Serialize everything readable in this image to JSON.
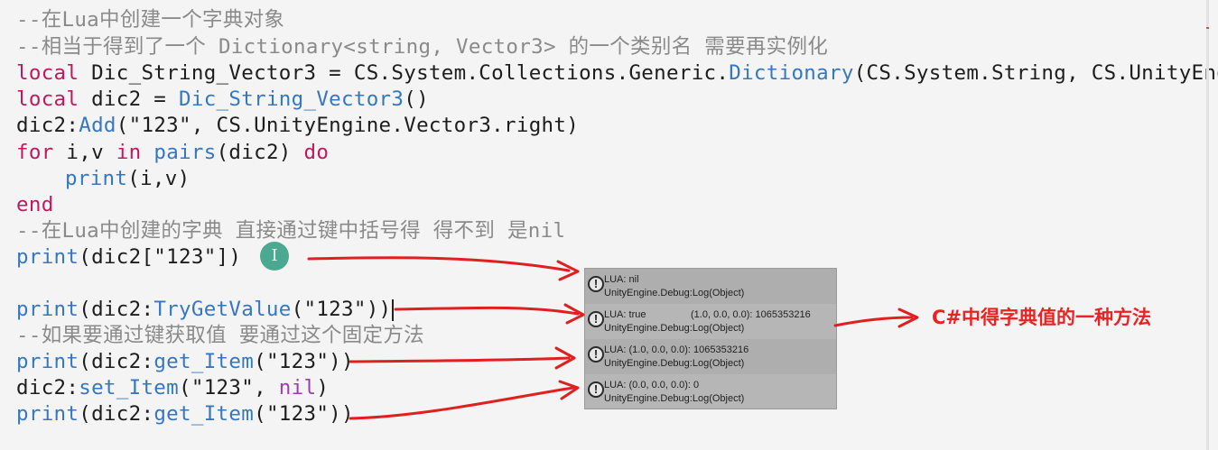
{
  "editor": {
    "lines": {
      "l1": "--在Lua中创建一个字典对象",
      "l2": "--相当于得到了一个 Dictionary<string, Vector3> 的一个类别名 需要再实例化",
      "l3": {
        "kw": "local",
        "rest1": " Dic_String_Vector3 = CS.System.Collections.Generic.",
        "fn": "Dictionary",
        "rest2": "(CS.System.String, CS.UnityEng"
      },
      "l4": {
        "kw": "local",
        "rest1": " dic2 = ",
        "fn": "Dic_String_Vector3",
        "rest2": "()"
      },
      "l5": {
        "pre": "dic2:",
        "fn": "Add",
        "rest": "(\"123\", CS.UnityEngine.Vector3.right)"
      },
      "l6": {
        "kw1": "for",
        "mid1": " i,v ",
        "kw2": "in",
        "mid2": " ",
        "fn": "pairs",
        "mid3": "(dic2) ",
        "kw3": "do"
      },
      "l7": {
        "fn": "print",
        "rest": "(i,v)"
      },
      "l8": "end",
      "l9": "--在Lua中创建的字典 直接通过键中括号得 得不到 是nil",
      "l10": {
        "fn": "print",
        "rest": "(dic2[\"123\"])"
      },
      "l11": {
        "fn": "print",
        "mid": "(dic2:",
        "fn2": "TryGetValue",
        "rest": "(\"123\"))"
      },
      "l12": "--如果要通过键获取值 要通过这个固定方法",
      "l13": {
        "fn": "print",
        "mid": "(dic2:",
        "fn2": "get_Item",
        "rest": "(\"123\"))"
      },
      "l14": {
        "pre": "dic2:",
        "fn": "set_Item",
        "mid": "(\"123\", ",
        "kv": "nil",
        "rest": ")"
      },
      "l15": {
        "fn": "print",
        "mid": "(dic2:",
        "fn2": "get_Item",
        "rest": "(\"123\"))"
      }
    },
    "cursor_glyph": "I"
  },
  "console": {
    "entries": [
      {
        "line1": "LUA: nil",
        "line2": "UnityEngine.Debug:Log(Object)"
      },
      {
        "line1": "LUA: true",
        "line1b": "(1.0, 0.0, 0.0): 1065353216",
        "line2": "UnityEngine.Debug:Log(Object)"
      },
      {
        "line1": "LUA: (1.0, 0.0, 0.0): 1065353216",
        "line2": "UnityEngine.Debug:Log(Object)"
      },
      {
        "line1": "LUA: (0.0, 0.0, 0.0): 0",
        "line2": "UnityEngine.Debug:Log(Object)"
      }
    ],
    "icon_glyph": "!"
  },
  "annotation": {
    "text": "C#中得字典值的一种方法",
    "color": "#ea2222"
  },
  "colors": {
    "keyword": "#c3185f",
    "function": "#3677c2",
    "comment": "#8a8a8a",
    "arrow": "#e02020"
  }
}
